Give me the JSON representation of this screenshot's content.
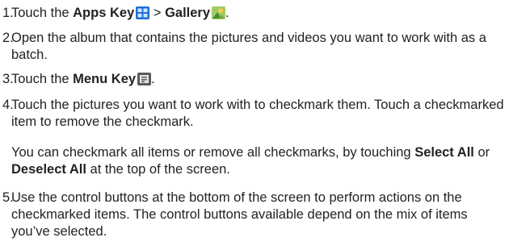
{
  "steps": [
    {
      "num": "1.",
      "pre": "Touch the ",
      "b1": "Apps Key",
      "mid": " > ",
      "b2": "Gallery",
      "post": "."
    },
    {
      "num": "2.",
      "text": "Open the album that contains the pictures and videos you want to work with as a batch."
    },
    {
      "num": "3.",
      "pre": "Touch the ",
      "b1": "Menu Key",
      "post": "."
    },
    {
      "num": "4.",
      "text": "Touch the pictures you want to work with to checkmark them. Touch a checkmarked item to remove the checkmark."
    },
    {
      "num": "5.",
      "text": "Use the control buttons at the bottom of the screen to perform actions on the checkmarked items. The control buttons available depend on the mix of items you’ve selected."
    }
  ],
  "note": {
    "pre": "You can checkmark all items or remove all checkmarks, by touching ",
    "select_all": "Select All",
    "or": " or ",
    "deselect_all": "Deselect All",
    "post": " at the top of the screen."
  },
  "icons": {
    "apps_key": "apps-grid-icon",
    "gallery": "gallery-icon",
    "menu_key": "menu-key-icon"
  }
}
